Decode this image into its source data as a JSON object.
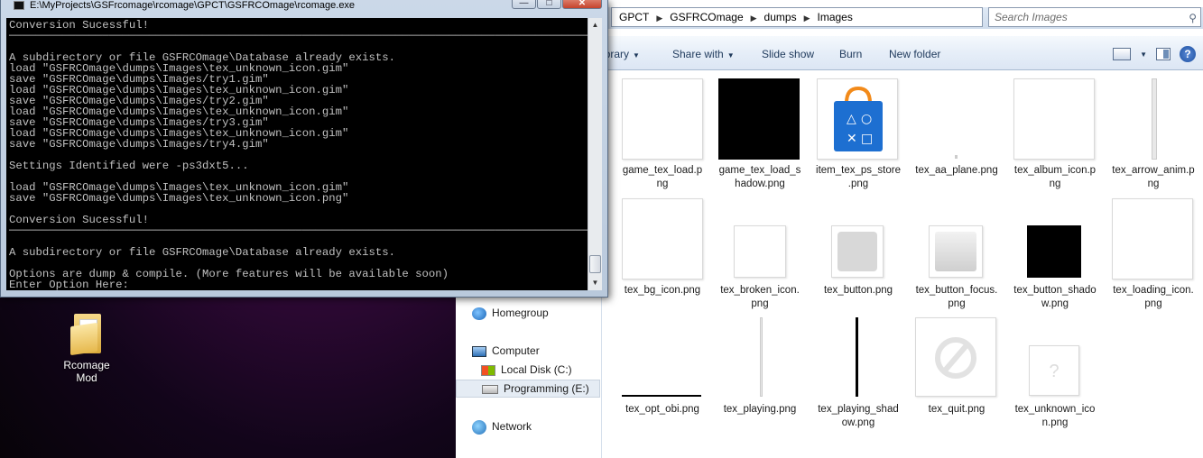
{
  "console": {
    "title": "E:\\MyProjects\\GSFrcomage\\rcomage\\GPCT\\GSFRCOmage\\rcomage.exe",
    "lines": "Conversion Sucessful!\n────────────────────────────────────────────────────────────────────────────────────────────────────────\n\nA subdirectory or file GSFRCOmage\\Database already exists.\nload \"GSFRCOmage\\dumps\\Images\\tex_unknown_icon.gim\"\nsave \"GSFRCOmage\\dumps\\Images/try1.gim\"\nload \"GSFRCOmage\\dumps\\Images\\tex_unknown_icon.gim\"\nsave \"GSFRCOmage\\dumps\\Images/try2.gim\"\nload \"GSFRCOmage\\dumps\\Images\\tex_unknown_icon.gim\"\nsave \"GSFRCOmage\\dumps\\Images/try3.gim\"\nload \"GSFRCOmage\\dumps\\Images\\tex_unknown_icon.gim\"\nsave \"GSFRCOmage\\dumps\\Images/try4.gim\"\n\nSettings Identified were -ps3dxt5...\n\nload \"GSFRCOmage\\dumps\\Images\\tex_unknown_icon.gim\"\nsave \"GSFRCOmage\\dumps\\Images\\tex_unknown_icon.png\"\n\nConversion Sucessful!\n────────────────────────────────────────────────────────────────────────────────────────────────────────\n\nA subdirectory or file GSFRCOmage\\Database already exists.\n\nOptions are dump & compile. (More features will be available soon)\nEnter Option Here:"
  },
  "desktop": {
    "icon_label_line1": "Rcomage",
    "icon_label_line2": "Mod"
  },
  "explorer": {
    "breadcrumb": [
      "GPCT",
      "GSFRCOmage",
      "dumps",
      "Images"
    ],
    "search_placeholder": "Search Images",
    "toolbar": {
      "library": "ibrary",
      "share_with": "Share with",
      "slide_show": "Slide show",
      "burn": "Burn",
      "new_folder": "New folder"
    },
    "nav": {
      "homegroup": "Homegroup",
      "computer": "Computer",
      "local_disk": "Local Disk (C:)",
      "programming": "Programming (E:)",
      "network": "Network"
    },
    "files": [
      {
        "l1": "game_tex_load.p",
        "l2": "ng"
      },
      {
        "l1": "game_tex_load_s",
        "l2": "hadow.png"
      },
      {
        "l1": "item_tex_ps_store",
        "l2": ".png"
      },
      {
        "l1": "tex_aa_plane.png",
        "l2": ""
      },
      {
        "l1": "tex_album_icon.p",
        "l2": "ng"
      },
      {
        "l1": "tex_arrow_anim.p",
        "l2": "ng"
      },
      {
        "l1": "tex_bg_icon.png",
        "l2": ""
      },
      {
        "l1": "tex_broken_icon.",
        "l2": "png"
      },
      {
        "l1": "tex_button.png",
        "l2": ""
      },
      {
        "l1": "tex_button_focus.",
        "l2": "png"
      },
      {
        "l1": "tex_button_shado",
        "l2": "w.png"
      },
      {
        "l1": "tex_loading_icon.",
        "l2": "png"
      },
      {
        "l1": "tex_opt_obi.png",
        "l2": ""
      },
      {
        "l1": "tex_playing.png",
        "l2": ""
      },
      {
        "l1": "tex_playing_shad",
        "l2": "ow.png"
      },
      {
        "l1": "tex_quit.png",
        "l2": ""
      },
      {
        "l1": "tex_unknown_ico",
        "l2": "n.png"
      }
    ]
  },
  "colors": {
    "console_bg": "#000000",
    "console_text": "#c0c0c0",
    "ps_store_blue": "#1d6fd1"
  }
}
